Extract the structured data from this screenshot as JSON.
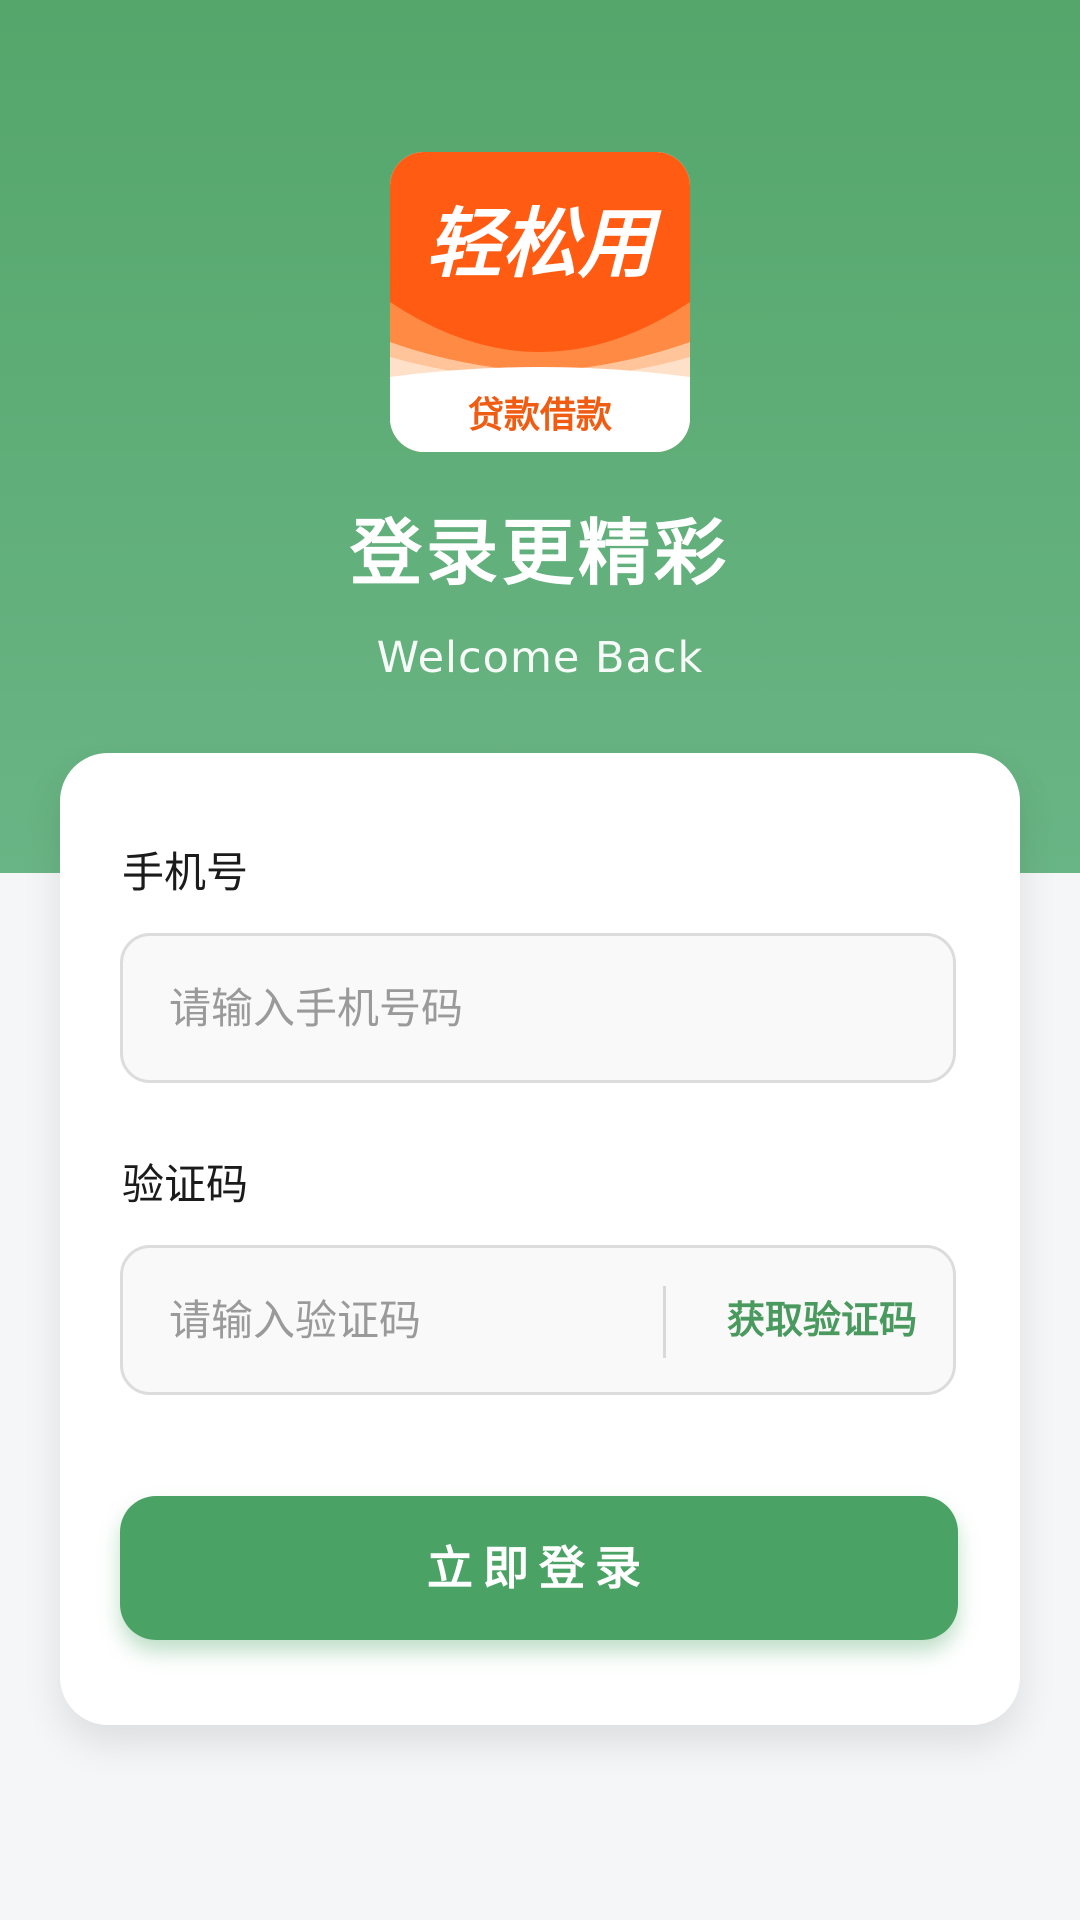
{
  "logo": {
    "main_text": "轻松用",
    "sub_text": "贷款借款",
    "brand_orange": "#ff5b12",
    "light_orange": "#ffc49a"
  },
  "hero": {
    "title": "登录更精彩",
    "subtitle": "Welcome Back",
    "bg_top": "#54a66b",
    "bg_bottom": "#6ab585"
  },
  "form": {
    "phone_label": "手机号",
    "phone_placeholder": "请输入手机号码",
    "code_label": "验证码",
    "code_placeholder": "请输入验证码",
    "get_code_label": "获取验证码",
    "login_label": "立即登录",
    "accent": "#4aa365"
  }
}
